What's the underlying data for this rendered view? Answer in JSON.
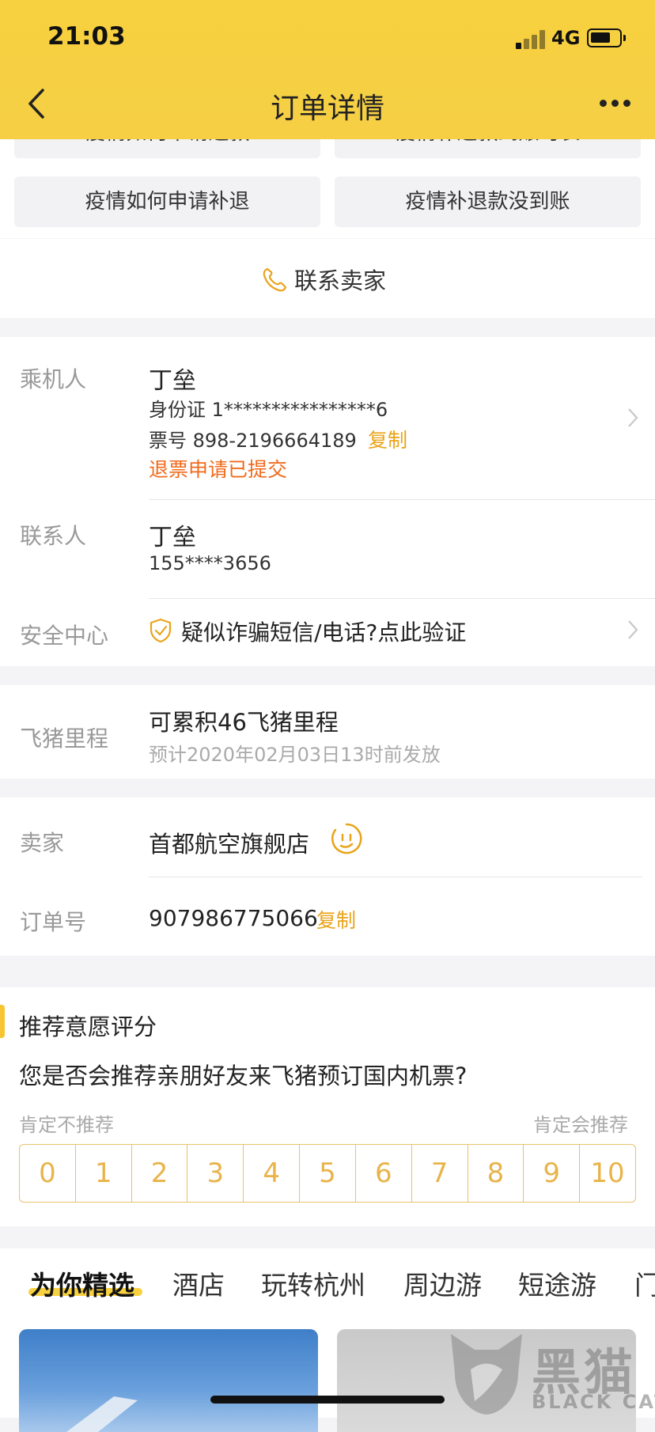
{
  "status_bar": {
    "time": "21:03",
    "network": "4G"
  },
  "header": {
    "title": "订单详情"
  },
  "faq": {
    "row1": [
      "疫情如何申请退款",
      "疫情补退款到账时长"
    ],
    "row2": [
      "疫情如何申请补退",
      "疫情补退款没到账"
    ]
  },
  "contact_seller": "联系卖家",
  "passenger": {
    "label": "乘机人",
    "name": "丁垒",
    "id_card": "身份证 1****************6",
    "ticket": "票号 898-2196664189",
    "copy": "复制",
    "refund_status": "退票申请已提交"
  },
  "contact_person": {
    "label": "联系人",
    "name": "丁垒",
    "phone": "155****3656"
  },
  "security": {
    "label": "安全中心",
    "text": "疑似诈骗短信/电话?点此验证"
  },
  "mileage": {
    "label": "飞猪里程",
    "text": "可累积46飞猪里程",
    "note": "预计2020年02月03日13时前发放"
  },
  "seller": {
    "label": "卖家",
    "name": "首都航空旗舰店"
  },
  "order": {
    "label": "订单号",
    "number": "907986775066",
    "copy": "复制"
  },
  "rating": {
    "title": "推荐意愿评分",
    "question": "您是否会推荐亲朋好友来飞猪预订国内机票?",
    "low_label": "肯定不推荐",
    "high_label": "肯定会推荐",
    "scores": [
      "0",
      "1",
      "2",
      "3",
      "4",
      "5",
      "6",
      "7",
      "8",
      "9",
      "10"
    ]
  },
  "recommend_tabs": [
    "为你精选",
    "酒店",
    "玩转杭州",
    "周边游",
    "短途游",
    "门"
  ],
  "watermark": "BLACK CAT",
  "colors": {
    "accent": "#f7d13f",
    "link": "#e9a41b",
    "alert": "#f06a1c"
  }
}
